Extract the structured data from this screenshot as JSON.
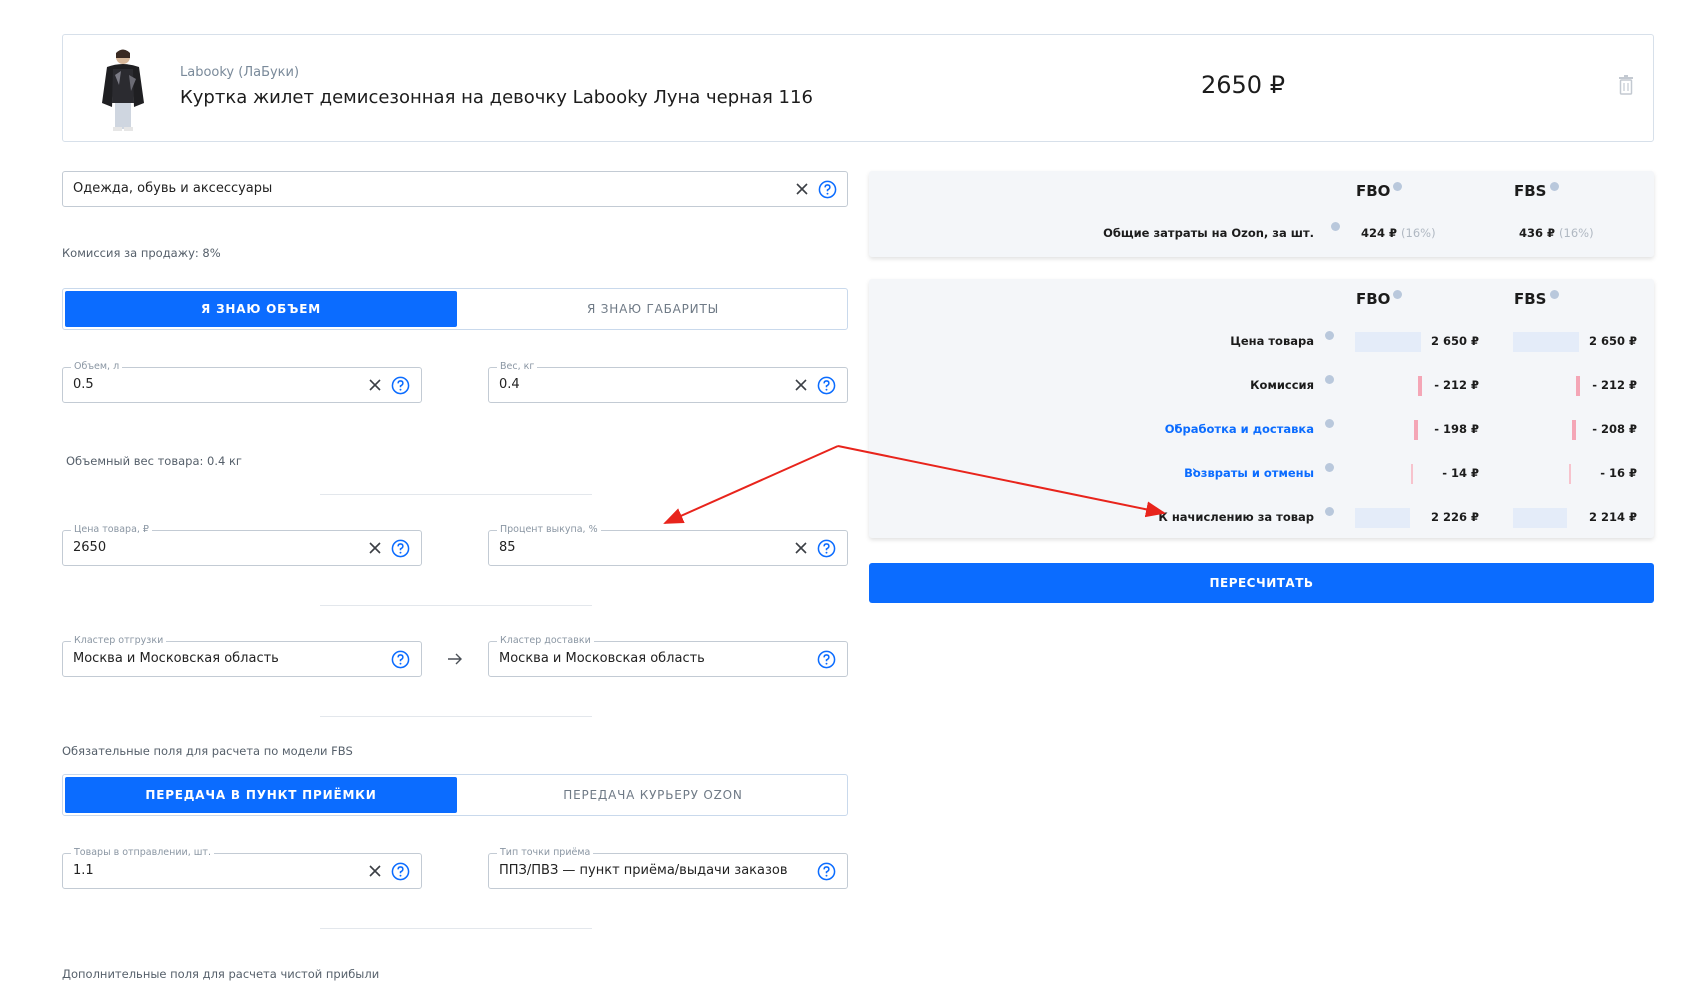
{
  "product": {
    "brand": "Labooky (ЛаБуки)",
    "title": "Куртка жилет демисезонная на девочку Labooky Луна черная 116",
    "price": "2650 ₽"
  },
  "category": {
    "value": "Одежда, обувь и аксессуары",
    "commission_note": "Комиссия за продажу: 8%"
  },
  "size_toggle": {
    "options": [
      "Я ЗНАЮ ОБЪЕМ",
      "Я ЗНАЮ ГАБАРИТЫ"
    ],
    "selected": "Я ЗНАЮ ОБЪЕМ"
  },
  "volume": {
    "label": "Объем, л",
    "value": "0.5"
  },
  "weight": {
    "label": "Вес, кг",
    "value": "0.4"
  },
  "volumetric_note": "Объемный вес товара: 0.4 кг",
  "price_field": {
    "label": "Цена товара, ₽",
    "value": "2650"
  },
  "buyout": {
    "label": "Процент выкупа, %",
    "value": "85"
  },
  "ship_cluster": {
    "label": "Кластер отгрузки",
    "value": "Москва и Московская область"
  },
  "delivery_cluster": {
    "label": "Кластер доставки",
    "value": "Москва и Московская область"
  },
  "fbs_note": "Обязательные поля для расчета по модели FBS",
  "fbs_toggle": {
    "options": [
      "ПЕРЕДАЧА В ПУНКТ ПРИЁМКИ",
      "ПЕРЕДАЧА КУРЬЕРУ OZON"
    ],
    "selected": "ПЕРЕДАЧА В ПУНКТ ПРИЁМКИ"
  },
  "items_in_shipment": {
    "label": "Товары в отправлении, шт.",
    "value": "1.1"
  },
  "point_type": {
    "label": "Тип точки приёма",
    "value": "ППЗ/ПВЗ — пункт приёма/выдачи заказов"
  },
  "extra_note": "Дополнительные поля для расчета чистой прибыли",
  "summary": {
    "col_fbo": "FBO",
    "col_fbs": "FBS",
    "total_label": "Общие затраты на Ozon, за шт.",
    "fbo_total": "424 ₽",
    "fbo_pct": "(16%)",
    "fbs_total": "436 ₽",
    "fbs_pct": "(16%)"
  },
  "breakdown": {
    "col_fbo": "FBO",
    "col_fbs": "FBS",
    "rows": [
      {
        "label": "Цена товара",
        "fbo": "2 650 ₽",
        "fbs": "2 650 ₽"
      },
      {
        "label": "Комиссия",
        "fbo": "- 212 ₽",
        "fbs": "- 212 ₽"
      },
      {
        "label": "Обработка и доставка",
        "fbo": "- 198 ₽",
        "fbs": "- 208 ₽"
      },
      {
        "label": "Возвраты и отмены",
        "fbo": "- 14 ₽",
        "fbs": "- 16 ₽"
      },
      {
        "label": "К начислению за товар",
        "fbo": "2 226 ₽",
        "fbs": "2 214 ₽"
      }
    ]
  },
  "recalc_label": "ПЕРЕСЧИТАТЬ",
  "colors": {
    "accent": "#0b6cff",
    "annotation_arrow": "#e8241c"
  }
}
